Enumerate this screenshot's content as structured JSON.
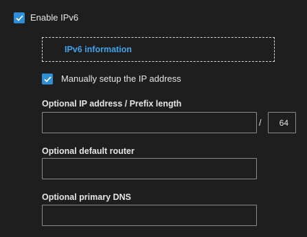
{
  "enable_ipv6": {
    "label": "Enable IPv6",
    "checked": true
  },
  "ipv6_information": {
    "label": "IPv6 information"
  },
  "manual_setup": {
    "label": "Manually setup the IP address",
    "checked": true
  },
  "ip_address": {
    "title": "Optional IP address / Prefix length",
    "value": "",
    "separator": "/",
    "prefix_length": "64"
  },
  "default_router": {
    "title": "Optional default router",
    "value": ""
  },
  "primary_dns": {
    "title": "Optional primary DNS",
    "value": ""
  },
  "colors": {
    "background": "#1e1e1e",
    "accent": "#2d8fd8",
    "link": "#3fa3ea",
    "border": "#8c8c8c"
  }
}
